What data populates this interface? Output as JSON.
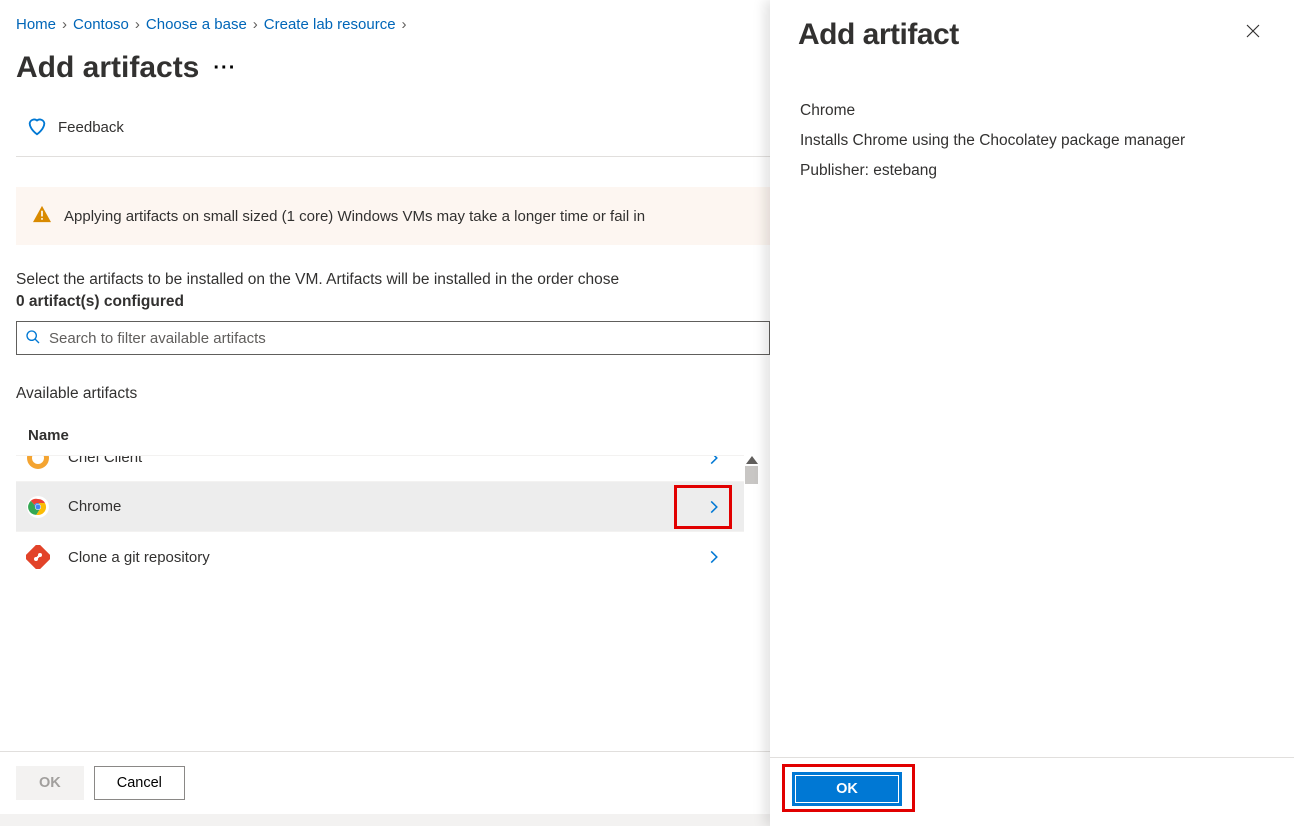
{
  "breadcrumb": [
    "Home",
    "Contoso",
    "Choose a base",
    "Create lab resource"
  ],
  "page_title": "Add artifacts",
  "feedback_label": "Feedback",
  "warning_text": "Applying artifacts on small sized (1 core) Windows VMs may take a longer time or fail in",
  "intro_text": "Select the artifacts to be installed on the VM. Artifacts will be installed in the order chose",
  "configured_count_text": "0 artifact(s) configured",
  "search_placeholder": "Search to filter available artifacts",
  "available_section": "Available artifacts",
  "name_col": "Name",
  "artifacts": [
    {
      "name": "Chef Client",
      "icon": "chef"
    },
    {
      "name": "Chrome",
      "icon": "chrome",
      "selected": true
    },
    {
      "name": "Clone a git repository",
      "icon": "git"
    }
  ],
  "footer": {
    "ok": "OK",
    "cancel": "Cancel"
  },
  "panel": {
    "title": "Add artifact",
    "name": "Chrome",
    "description": "Installs Chrome using the Chocolatey package manager",
    "publisher_label": "Publisher: estebang",
    "ok": "OK"
  }
}
